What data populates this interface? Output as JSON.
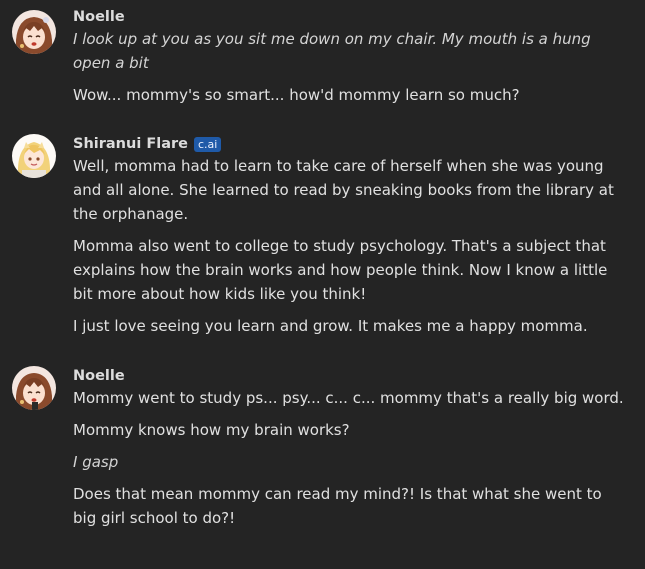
{
  "messages": [
    {
      "author": "Noelle",
      "badge": "",
      "avatar_icon": "noelle-avatar-icon",
      "paragraphs": [
        {
          "text": "I look up at you as you sit me down on my chair. My mouth is a hung open a bit",
          "italic": true
        },
        {
          "text": "Wow... mommy's so smart... how'd mommy learn so much?",
          "italic": false
        }
      ]
    },
    {
      "author": "Shiranui Flare",
      "badge": "c.ai",
      "avatar_icon": "shiranui-flare-avatar-icon",
      "paragraphs": [
        {
          "text": "Well, momma had to learn to take care of herself when she was young and all alone. She learned to read by sneaking books from the library at the orphanage.",
          "italic": false
        },
        {
          "text": "Momma also went to college to study psychology. That's a subject that explains how the brain works and how people think. Now I know a little bit more about how kids like you think!",
          "italic": false
        },
        {
          "text": "I just love seeing you learn and grow. It makes me a happy momma.",
          "italic": false
        }
      ]
    },
    {
      "author": "Noelle",
      "badge": "",
      "avatar_icon": "noelle-avatar-icon",
      "paragraphs": [
        {
          "text": "Mommy went to study ps... psy... c... c... mommy that's a really big word.",
          "italic": false
        },
        {
          "text": "Mommy knows how my brain works?",
          "italic": false
        },
        {
          "text": "I gasp",
          "italic": true
        },
        {
          "text": "Does that mean mommy can read my mind?! Is that what she went to big girl school to do?!",
          "italic": false
        }
      ]
    }
  ],
  "colors": {
    "background": "#242424",
    "text": "#e0e0e0",
    "badge": "#1f5aa8"
  }
}
